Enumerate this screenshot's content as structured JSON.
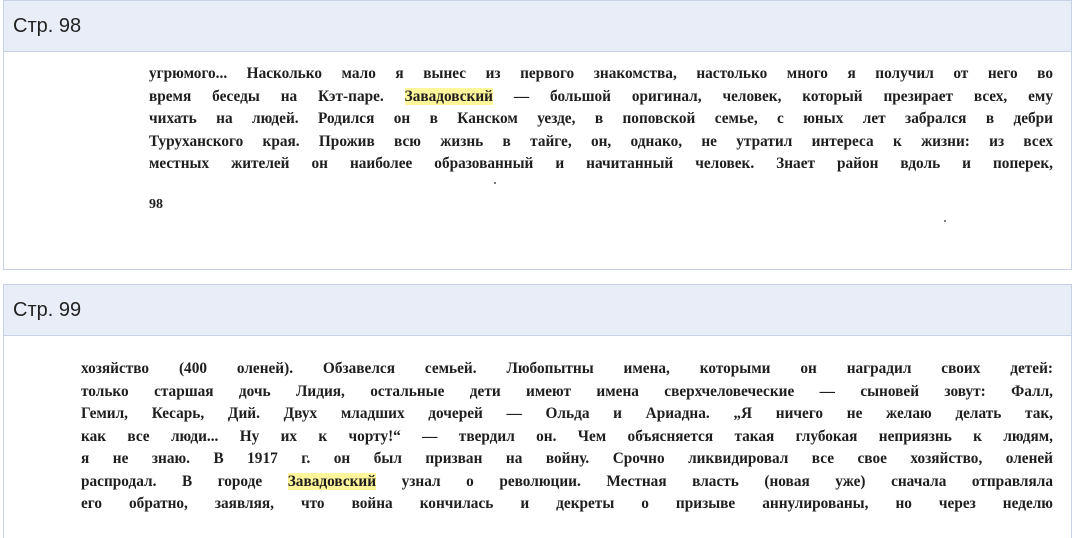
{
  "pages": [
    {
      "header": "Стр. 98",
      "lines": [
        {
          "text": "угрюмого... Насколько мало я вынес из первого знакомства, настолько много я получил от него во"
        },
        {
          "pre": "время беседы на Кэт-паре. ",
          "hl": "Завадовский",
          "post": " — большой оригинал, человек, который презирает всех, ему"
        },
        {
          "text": "чихать на людей. Родился он в Канском уезде, в поповской семье, с юных лет забрался в дебри"
        },
        {
          "text": "Туруханского края. Прожив всю жизнь в тайге, он, однако, не утратил интереса к жизни: из всех"
        },
        {
          "text": "местных жителей он наиболее образованный и начитанный человек. Знает район вдоль и поперек,"
        }
      ],
      "folio": "98"
    },
    {
      "header": "Стр. 99",
      "lines": [
        {
          "text": "хозяйство (400 оленей). Обзавелся семьей. Любопытны имена, которыми он наградил своих детей:"
        },
        {
          "text": "только старшая дочь Лидия, остальные дети имеют имена сверхчеловеческие — сыновей зовут: Фалл,"
        },
        {
          "text": "Гемил, Кесарь, Дий. Двух младших дочерей — Ольда и Ариадна. „Я ничего не желаю делать так,"
        },
        {
          "text": "как все люди... Ну их к чорту!“ — твердил он. Чем объясняется такая глубокая неприязнь к людям,"
        },
        {
          "text": "я не знаю. В 1917 г. он был призван на войну. Срочно ликвидировал все свое хозяйство, оленей"
        },
        {
          "pre": "распродал. В городе ",
          "hl": "Завадовский",
          "post": " узнал о революции. Местная власть (новая уже) сначала отправляла"
        },
        {
          "text": "его обратно, заявляя, что война кончилась и декреты о призыве аннулированы, но через неделю"
        }
      ]
    }
  ]
}
